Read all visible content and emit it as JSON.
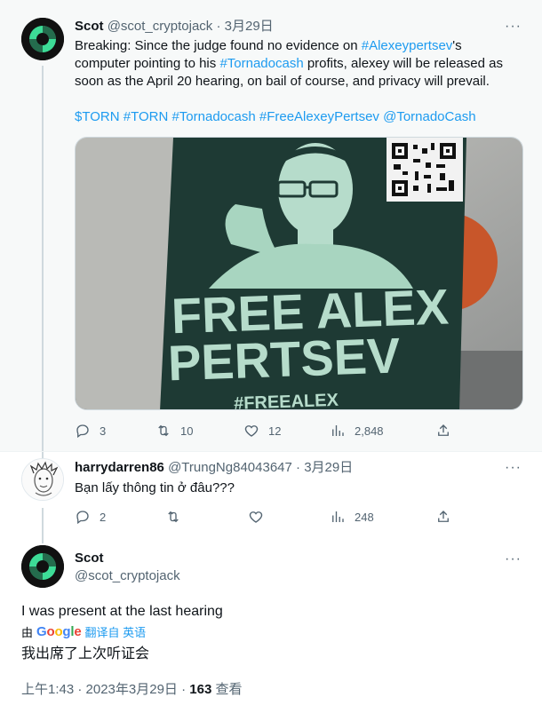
{
  "tweet1": {
    "name": "Scot",
    "handle": "@scot_cryptojack",
    "separator": "·",
    "date": "3月29日",
    "text": {
      "p1": "Breaking: Since the judge found no evidence on ",
      "l1": "#Alexeypertsev",
      "p2": "'s computer pointing to his ",
      "l2": "#Tornadocash",
      "p3": " profits, alexey will be released as soon as the April 20 hearing, on bail of course, and privacy will prevail.",
      "tags": "$TORN #TORN #Tornadocash #FreeAlexeyPertsev @TornadoCash"
    },
    "media": {
      "poster_line1": "FREE ALEX",
      "poster_line2": "PERTSEV",
      "poster_hashtag": "#FREEALEX"
    },
    "actions": {
      "reply": "3",
      "retweet": "10",
      "like": "12",
      "views": "2,848"
    }
  },
  "tweet2": {
    "name": "harrydarren86",
    "handle": "@TrungNg84043647",
    "separator": "·",
    "date": "3月29日",
    "text": "Bạn lấy thông tin ở đâu???",
    "actions": {
      "reply": "2",
      "views": "248"
    }
  },
  "tweet3": {
    "name": "Scot",
    "handle": "@scot_cryptojack",
    "text": "I was present at the last hearing",
    "translate_by": "由",
    "translate_from": "翻译自 英语",
    "translation": "我出席了上次听证会",
    "meta": "上午1:43 · 2023年3月29日 · ",
    "views_count": "163",
    "views_label": " 查看"
  },
  "icons": [
    "reply-icon",
    "retweet-icon",
    "like-icon",
    "views-icon",
    "share-icon",
    "more-icon"
  ],
  "colors": {
    "accent": "#1d9bf0",
    "secondary": "#536471",
    "poster_green": "#a8d5c0",
    "poster_dark": "#1d3a33"
  }
}
